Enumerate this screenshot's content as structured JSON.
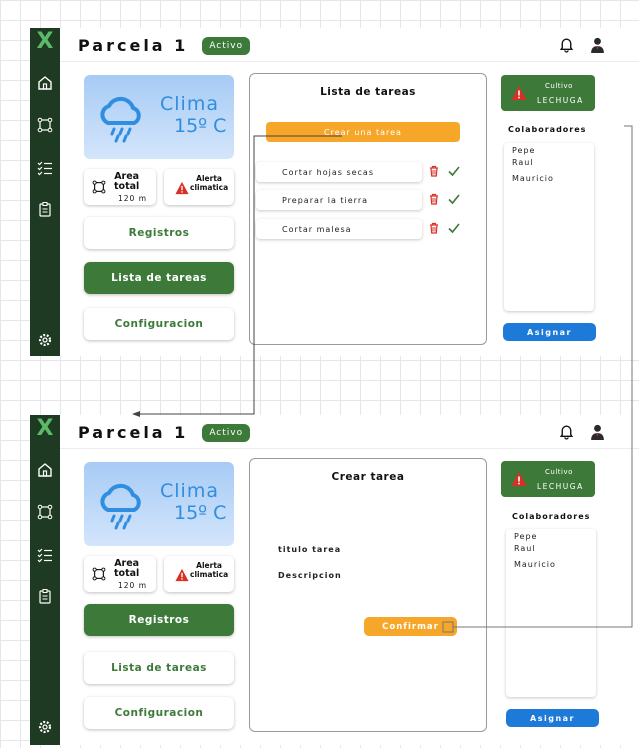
{
  "app": {
    "title": "Parcela 1",
    "status_badge": "Activo"
  },
  "sidebar": {
    "logo": "X",
    "icons": [
      "home-icon",
      "nodes-icon",
      "checklist-icon",
      "clipboard-icon",
      "settings-icon"
    ]
  },
  "weather": {
    "label": "Clima",
    "temperature": "15º C",
    "icon": "cloud-rain-icon"
  },
  "area": {
    "label_line1": "Area",
    "label_line2": "total",
    "value": "120 m"
  },
  "alert": {
    "label_line1": "Alerta",
    "label_line2": "climatica"
  },
  "menu": {
    "registros": "Registros",
    "lista_tareas": "Lista de tareas",
    "configuracion": "Configuracion"
  },
  "screen1": {
    "panel_title": "Lista de tareas",
    "create_button": "Crear una tarea",
    "tasks": [
      "Cortar hojas secas",
      "Preparar la tierra",
      "Cortar malesa"
    ]
  },
  "screen2": {
    "panel_title": "Crear tarea",
    "field_title": "titulo tarea",
    "field_description": "Descripcion",
    "confirm_button": "Confirmar"
  },
  "crop": {
    "label": "Cultivo",
    "name": "LECHUGA"
  },
  "collaborators": {
    "title": "Colaboradores",
    "names": [
      "Pepe",
      "Raul",
      "Mauricio"
    ],
    "assign_button": "Asignar"
  },
  "colors": {
    "sidebar": "#1f3a22",
    "primary_green": "#3d7a3a",
    "accent_orange": "#f6a628",
    "accent_blue": "#1e7ad8",
    "danger_red": "#d93025"
  }
}
